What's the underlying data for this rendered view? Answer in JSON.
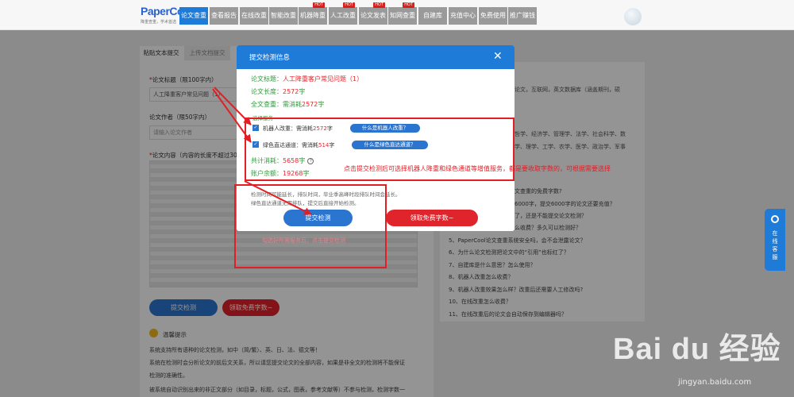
{
  "brand": {
    "name": "PaperCool",
    "sub": "降重查重，学术首选"
  },
  "nav": [
    {
      "label": "论文查重",
      "active": true,
      "hot": false
    },
    {
      "label": "查看报告",
      "active": false,
      "hot": false
    },
    {
      "label": "在线改重",
      "active": false,
      "hot": false
    },
    {
      "label": "智能改重",
      "active": false,
      "hot": false
    },
    {
      "label": "机器降重",
      "active": false,
      "hot": true
    },
    {
      "label": "人工改重",
      "active": false,
      "hot": true
    },
    {
      "label": "论文发表",
      "active": false,
      "hot": true
    },
    {
      "label": "知网查重",
      "active": false,
      "hot": true
    },
    {
      "label": "自建库",
      "active": false,
      "hot": false
    },
    {
      "label": "充值中心",
      "active": false,
      "hot": false
    },
    {
      "label": "免费使用",
      "active": false,
      "hot": false
    },
    {
      "label": "推广赚钱",
      "active": false,
      "hot": false
    }
  ],
  "hot_badge": "HOT",
  "form": {
    "tab_paste": "粘贴文本提交",
    "tab_upload": "上传文档提交",
    "title_label": "论文标题（限100字内）",
    "title_value": "人工降重客户常见问题（1）",
    "author_label": "论文作者（限50字内）",
    "author_placeholder": "请输入论文作者",
    "content_label": "论文内容（内容的长度不超过30",
    "submit": "提交检测",
    "free": "领取免费字数~"
  },
  "tips": {
    "title": "温馨提示",
    "lines": [
      "系统支持所有语种的论文检测，如中（简/繁）、英、日、法、德文等！",
      "系统在检测时会分析论文的前后文关系，所以请您提交论文的全部内容，如果是非全文的检测将不能保证",
      "检测的准确性。",
      "被系统自动识别出来的非正文部分（如目录，标题，公式，图表，参考文献等）不参与检测，检测字数一"
    ]
  },
  "right_panel": {
    "frag_1": "论文，互联网，英文数据库（涵盖期刊，硕",
    "frag_2": "哲学、经济学、管理学、法学、社会科学、数",
    "frag_3": "学、理学、工学、农学、医学、政治学、军事",
    "faq": [
      "文查重的免费字数?",
      "6000字，提交6000字的论文还要充值？",
      "了，还是不能提交论文检测？",
      "么收费？多久可以检测好？",
      "5、PaperCool论文查重系统安全吗，会不会泄露论文？",
      "6、为什么论文检测把论文中的“引用”也标红了？",
      "7、自建库是什么意思？怎么使用？",
      "8、机器人改重怎么收费？",
      "9、机器人改重效果怎么样？改重后还需要人工修改吗?",
      "10、在线改重怎么收费？",
      "11、在线改重后的论文会自动保存到编辑器吗？"
    ]
  },
  "modal": {
    "title": "提交检测信息",
    "close": "✕",
    "paper_title_label": "论文标题：",
    "paper_title_value": "人工降重客户常见问题（1）",
    "length_label": "论文长度：",
    "length_value": "2572",
    "char_unit": "字",
    "full_check_label": "全文查重：",
    "full_check_prefix": "需消耗",
    "full_check_value": "2572",
    "option_heading": "选择服务",
    "option_robot_label": "机器人改重：",
    "option_robot_prefix": "需消耗",
    "option_robot_value": "2572",
    "option_robot_help": "什么是机器人改重？",
    "option_green_label": "绿色直达通道：",
    "option_green_prefix": "需消耗",
    "option_green_value": "514",
    "option_green_help": "什么是绿色直达通道？",
    "total_label": "共计消耗：",
    "total_value": "5658",
    "help_mark": "?",
    "balance_label": "账户余额：",
    "balance_value": "19268",
    "note_1": "检测时间可能延长，排队时间，毕业季高峰时段排队时间会延长。",
    "note_2": "绿色直达通道无需排队，提交后直接开始检测。",
    "submit": "提交检测",
    "free": "领取免费字数~"
  },
  "annotations": {
    "main": "点击提交检测后可选择机器人降重和绿色通道等增值服务，都是要收取字数的，可根据需要选择",
    "faint": "勾选好所需服务后，点击提交检测"
  },
  "online_service": "在线客服",
  "watermark": {
    "logo": "Bai du 经验",
    "url": "jingyan.baidu.com"
  },
  "colors": {
    "primary": "#1e7bd8",
    "danger": "#e0242b",
    "success": "#2e9a3a",
    "annotation": "#e31e25"
  }
}
